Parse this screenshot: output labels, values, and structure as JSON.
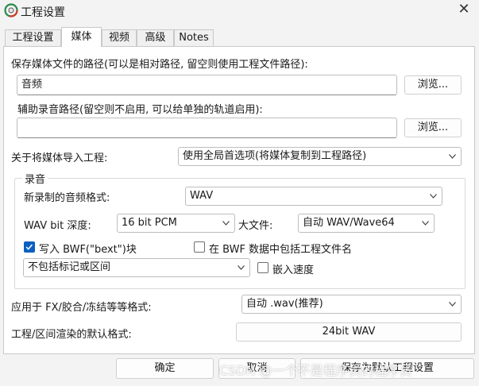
{
  "window": {
    "title": "工程设置",
    "close_glyph": "✕",
    "app_icon": "reaper-logo-icon"
  },
  "tabs": [
    "工程设置",
    "媒体",
    "视频",
    "高级",
    "Notes"
  ],
  "active_tab": "媒体",
  "media_path": {
    "label": "保存媒体文件的路径(可以是相对路径, 留空则使用工程文件路径):",
    "value": "音频",
    "browse": "浏览..."
  },
  "secondary_path": {
    "label": "辅助录音路径(留空则不启用, 可以给单独的轨道启用):",
    "value": "",
    "browse": "浏览..."
  },
  "import": {
    "label": "关于将媒体导入工程:",
    "value": "使用全局首选项(将媒体复制到工程路径)"
  },
  "recording": {
    "group_title": "录音",
    "format_label": "新录制的音频格式:",
    "format_value": "WAV",
    "bitdepth_label": "WAV bit 深度:",
    "bitdepth_value": "16 bit PCM",
    "largefile_label": "大文件:",
    "largefile_value": "自动 WAV/Wave64",
    "bwf_label": "写入 BWF(\"bext\")块",
    "bwf_checked": true,
    "bwf_projname_label": "在 BWF 数据中包括工程文件名",
    "bwf_projname_checked": false,
    "markers_value": "不包括标记或区间",
    "embed_tempo_label": "嵌入速度",
    "embed_tempo_checked": false
  },
  "fx_format": {
    "label": "应用于 FX/胶合/冻结等等格式:",
    "value": "自动 .wav(推荐)"
  },
  "render_format": {
    "label": "工程/区间渲染的默认格式:",
    "value": "24bit WAV"
  },
  "buttons": {
    "ok": "确定",
    "cancel": "取消",
    "save_default": "保存为默认工程设置"
  },
  "watermark": "CSDN @一个不是程序员的程序员",
  "colors": {
    "accent": "#0a5fc0",
    "background": "#f3f3f3",
    "panel": "#ffffff"
  }
}
